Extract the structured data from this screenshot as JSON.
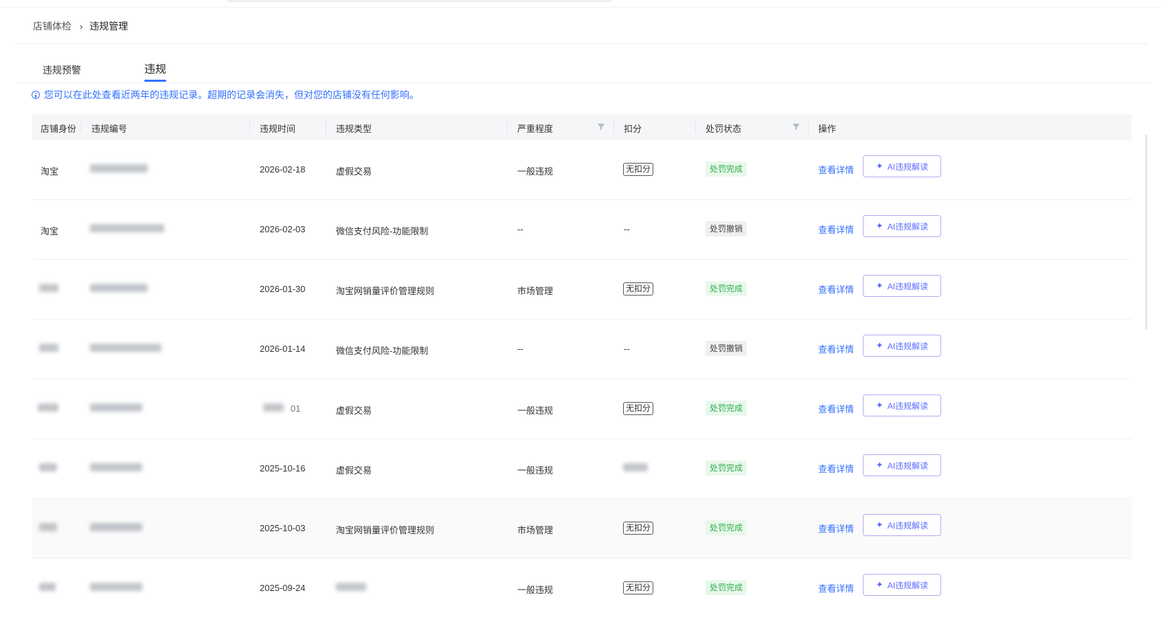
{
  "breadcrumb": {
    "parent": "店铺体检",
    "separator": "›",
    "current": "违规管理"
  },
  "tabs": [
    {
      "label": "违规预警"
    },
    {
      "label": "违规"
    }
  ],
  "notice": "您可以在此处查看近两年的违规记录。超期的记录会消失，但对您的店铺没有任何影响。",
  "table": {
    "columns": {
      "shop": "店铺身份",
      "id": "违规编号",
      "time": "违规时间",
      "type": "违规类型",
      "severity": "严重程度",
      "points": "扣分",
      "status": "处罚状态",
      "action": "操作"
    },
    "rows": [
      {
        "shop": "淘宝",
        "time": "2026-02-18",
        "type": "虚假交易",
        "severity": "一般违规",
        "points": "无扣分",
        "status": "处罚完成",
        "status_kind": "done",
        "detail": "查看详情",
        "ai": "AI违规解读"
      },
      {
        "shop": "淘宝",
        "time": "2026-02-03",
        "type": "微信支付风险-功能限制",
        "severity": "--",
        "points": "--",
        "status": "处罚撤销",
        "status_kind": "revoked",
        "detail": "查看详情",
        "ai": "AI违规解读"
      },
      {
        "shop": "",
        "time": "2026-01-30",
        "type": "淘宝网销量评价管理规则",
        "severity": "市场管理",
        "points": "无扣分",
        "status": "处罚完成",
        "status_kind": "done",
        "detail": "查看详情",
        "ai": "AI违规解读"
      },
      {
        "shop": "",
        "time": "2026-01-14",
        "type": "微信支付风险-功能限制",
        "severity": "--",
        "points": "--",
        "status": "处罚撤销",
        "status_kind": "revoked",
        "detail": "查看详情",
        "ai": "AI违规解读"
      },
      {
        "shop": "",
        "time": "01",
        "type": "虚假交易",
        "severity": "一般违规",
        "points": "无扣分",
        "status": "处罚完成",
        "status_kind": "done",
        "detail": "查看详情",
        "ai": "AI违规解读"
      },
      {
        "shop": "",
        "time": "2025-10-16",
        "type": "虚假交易",
        "severity": "一般违规",
        "points": "",
        "status": "处罚完成",
        "status_kind": "done",
        "detail": "查看详情",
        "ai": "AI违规解读"
      },
      {
        "shop": "",
        "time": "2025-10-03",
        "type": "淘宝网销量评价管理规则",
        "severity": "市场管理",
        "points": "无扣分",
        "status": "处罚完成",
        "status_kind": "done",
        "detail": "查看详情",
        "ai": "AI违规解读"
      },
      {
        "shop": "",
        "time": "2025-09-24",
        "type": "",
        "severity": "一般违规",
        "points": "无扣分",
        "status": "处罚完成",
        "status_kind": "done",
        "detail": "查看详情",
        "ai": "AI违规解读"
      }
    ]
  }
}
